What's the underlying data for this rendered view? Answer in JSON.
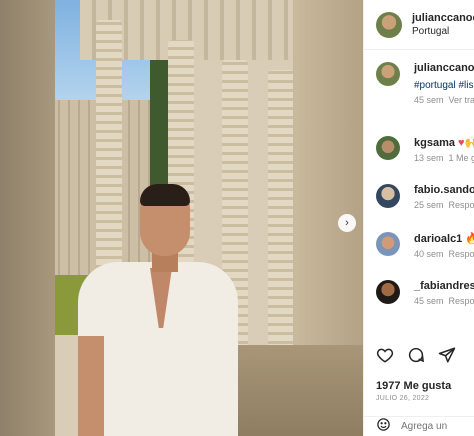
{
  "post": {
    "username": "julianccanoc",
    "location": "Portugal"
  },
  "caption": {
    "username": "julianccanoc",
    "text": "#portugal #lis",
    "time": "45 sem",
    "action": "Ver tra"
  },
  "comments": [
    {
      "username": "kgsama",
      "suffix": "♥🙌",
      "time": "13 sem",
      "action": "1 Me g"
    },
    {
      "username": "fabio.sandov",
      "suffix": "",
      "time": "25 sem",
      "action": "Respo"
    },
    {
      "username": "darioalc1",
      "suffix": "🔥🔥",
      "time": "40 sem",
      "action": "Respo"
    },
    {
      "username": "_fabiandress",
      "suffix": "",
      "time": "45 sem",
      "action": "Respo"
    }
  ],
  "likes": "1977 Me gusta",
  "date": "JULIO 26, 2022",
  "comment_input": {
    "placeholder": "Agrega un"
  },
  "icons": {
    "like": "heart-icon",
    "comment": "comment-icon",
    "share": "share-icon",
    "next": "chevron-right-icon",
    "emoji": "smiley-icon"
  },
  "colors": {
    "link": "#00376b",
    "muted": "#8e8e8e",
    "like": "#ed4956"
  }
}
